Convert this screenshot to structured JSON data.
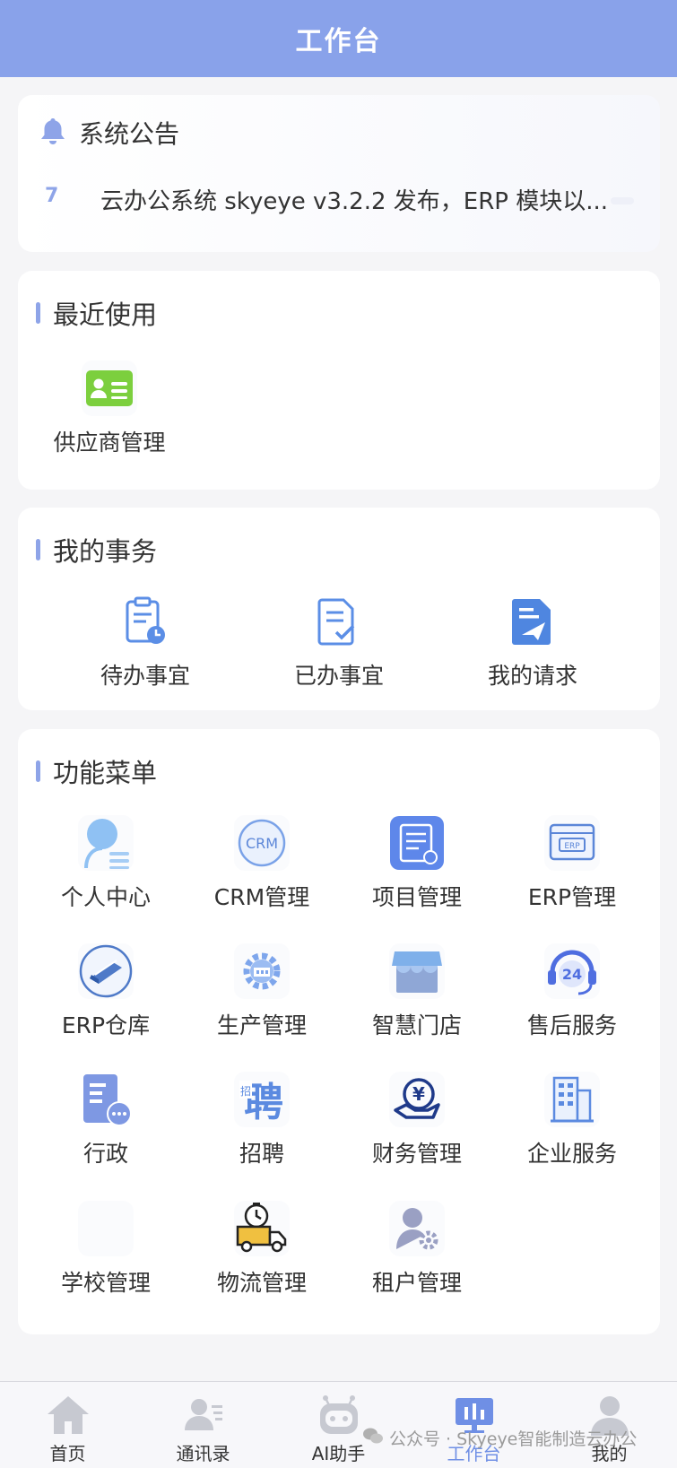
{
  "header": {
    "title": "工作台"
  },
  "notice": {
    "title": "系统公告",
    "index": "7",
    "message": "云办公系统 skyeye v3.2.2 发布，ERP 模块以..."
  },
  "recent": {
    "title": "最近使用",
    "items": [
      {
        "label": "供应商管理",
        "icon": "supplier-card-icon"
      }
    ]
  },
  "tasks": {
    "title": "我的事务",
    "items": [
      {
        "label": "待办事宜",
        "icon": "clipboard-clock-icon"
      },
      {
        "label": "已办事宜",
        "icon": "document-check-icon"
      },
      {
        "label": "我的请求",
        "icon": "document-send-icon"
      }
    ]
  },
  "menu": {
    "title": "功能菜单",
    "items": [
      {
        "label": "个人中心",
        "icon": "person-icon"
      },
      {
        "label": "CRM管理",
        "icon": "crm-icon"
      },
      {
        "label": "项目管理",
        "icon": "project-icon"
      },
      {
        "label": "ERP管理",
        "icon": "erp-icon"
      },
      {
        "label": "ERP仓库",
        "icon": "warehouse-icon"
      },
      {
        "label": "生产管理",
        "icon": "production-gear-icon"
      },
      {
        "label": "智慧门店",
        "icon": "store-icon"
      },
      {
        "label": "售后服务",
        "icon": "support-24-icon"
      },
      {
        "label": "行政",
        "icon": "admin-doc-icon"
      },
      {
        "label": "招聘",
        "icon": "recruit-icon"
      },
      {
        "label": "财务管理",
        "icon": "finance-yen-icon"
      },
      {
        "label": "企业服务",
        "icon": "building-icon"
      },
      {
        "label": "学校管理",
        "icon": "school-icon"
      },
      {
        "label": "物流管理",
        "icon": "logistics-truck-icon"
      },
      {
        "label": "租户管理",
        "icon": "tenant-icon"
      }
    ]
  },
  "crm_text": "CRM",
  "erp_text": "ERP",
  "support_text": "24",
  "recruit_text": "聘",
  "recruit_small": "招",
  "yen_text": "¥",
  "tabbar": {
    "items": [
      {
        "label": "首页",
        "icon": "home-icon"
      },
      {
        "label": "通讯录",
        "icon": "contacts-icon"
      },
      {
        "label": "AI助手",
        "icon": "robot-icon"
      },
      {
        "label": "工作台",
        "icon": "dashboard-icon",
        "active": true
      },
      {
        "label": "我的",
        "icon": "profile-icon"
      }
    ]
  },
  "watermark": "公众号 · Skyeye智能制造云办公",
  "colors": {
    "primary": "#89a2ea",
    "accent": "#8ea4e8",
    "active_tab": "#6f8fe5"
  }
}
